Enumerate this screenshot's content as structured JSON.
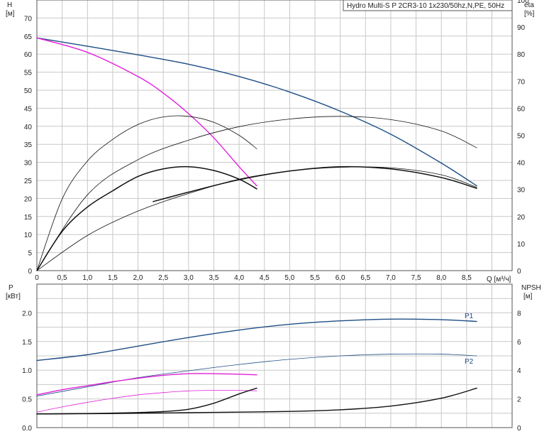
{
  "title": "Hydro Multi-S P 2CR3-10 1x230/50hz,N,PE, 50Hz",
  "colors": {
    "blue": "#1f4e86",
    "magenta": "#e020d8",
    "black": "#111111",
    "grid": "#c8c8c8"
  },
  "top_chart": {
    "y_left_label": "H",
    "y_left_unit": "[м]",
    "y_right_label": "eta",
    "y_right_unit": "[%]",
    "x_label": "Q [м³/ч]",
    "x_ticks": [
      "0",
      "0,5",
      "1,0",
      "1,5",
      "2,0",
      "2,5",
      "3,0",
      "3,5",
      "4,0",
      "4,5",
      "5,0",
      "5,5",
      "6,0",
      "6,5",
      "7,0",
      "7,5",
      "8,0",
      "8,5"
    ],
    "y_left_ticks": [
      "0",
      "5",
      "10",
      "15",
      "20",
      "25",
      "30",
      "35",
      "40",
      "45",
      "50",
      "55",
      "60",
      "65",
      "70"
    ],
    "y_right_ticks": [
      "0",
      "10",
      "20",
      "30",
      "40",
      "50",
      "60",
      "70",
      "80",
      "90",
      "100"
    ]
  },
  "bottom_chart": {
    "y_left_label": "P",
    "y_left_unit": "[кВт]",
    "y_right_label": "NPSH",
    "y_right_unit": "[м]",
    "y_left_ticks": [
      "0.0",
      "0.5",
      "1.0",
      "1.5",
      "2.0"
    ],
    "y_right_ticks": [
      "0",
      "2",
      "4",
      "6",
      "8"
    ],
    "series_labels": {
      "p1": "P1",
      "p2": "P2"
    }
  },
  "chart_data": [
    {
      "type": "line",
      "xlim": [
        0,
        9.4
      ],
      "ylim": [
        0,
        75
      ],
      "y2lim": [
        0,
        100
      ],
      "series": [
        {
          "key": "h_blue",
          "axis": "left",
          "color": "#1f4e86",
          "width": 1.4,
          "x": [
            0,
            1,
            2,
            3,
            4,
            5,
            6,
            7,
            8,
            8.7
          ],
          "y": [
            64.5,
            62.2,
            59.8,
            57.2,
            53.8,
            49.5,
            44.2,
            37.8,
            29.8,
            23.5
          ]
        },
        {
          "key": "h_magenta",
          "axis": "left",
          "color": "#e020d8",
          "width": 1.4,
          "x": [
            0,
            1,
            2,
            2.5,
            3,
            3.5,
            4,
            4.35
          ],
          "y": [
            64.5,
            60.5,
            53.8,
            49.2,
            43.5,
            36.8,
            28.8,
            23.5
          ]
        },
        {
          "key": "eta_thin_small",
          "axis": "right",
          "color": "#111111",
          "width": 0.8,
          "x": [
            0,
            0.5,
            1,
            1.5,
            2,
            2.5,
            3,
            3.5,
            4,
            4.35
          ],
          "y": [
            0,
            26.5,
            40.5,
            48.5,
            54.0,
            56.8,
            57.0,
            54.8,
            50.0,
            45.0
          ]
        },
        {
          "key": "eta_thick_small",
          "axis": "right",
          "color": "#111111",
          "width": 1.5,
          "x": [
            0,
            0.5,
            1,
            1.5,
            2,
            2.5,
            3,
            3.5,
            4,
            4.35
          ],
          "y": [
            0,
            14.5,
            23.5,
            29.5,
            34.8,
            37.6,
            38.4,
            37.0,
            33.8,
            30.2
          ]
        },
        {
          "key": "eta_thin_big",
          "axis": "right",
          "color": "#111111",
          "width": 0.8,
          "x": [
            0,
            1,
            2,
            3,
            4,
            5,
            6,
            7,
            8,
            8.7
          ],
          "y": [
            0,
            28.0,
            41.0,
            48.2,
            53.2,
            56.0,
            57.0,
            55.8,
            51.6,
            45.4
          ]
        },
        {
          "key": "eta_thin_big2",
          "axis": "right",
          "color": "#111111",
          "width": 0.8,
          "x": [
            0,
            1,
            2,
            3,
            4,
            5,
            6,
            7,
            8,
            8.7
          ],
          "y": [
            0,
            13.0,
            22.0,
            28.5,
            33.8,
            36.8,
            38.2,
            38.0,
            35.4,
            30.8
          ]
        },
        {
          "key": "eta_thick_big",
          "axis": "right",
          "color": "#111111",
          "width": 1.5,
          "x": [
            2.3,
            3,
            4,
            5,
            6,
            7,
            8,
            8.7
          ],
          "y": [
            25.5,
            29.0,
            33.6,
            36.8,
            38.4,
            37.6,
            34.4,
            30.4
          ]
        }
      ]
    },
    {
      "type": "line",
      "xlim": [
        0,
        9.4
      ],
      "ylim": [
        0,
        2.5
      ],
      "y2lim": [
        0,
        10
      ],
      "series": [
        {
          "key": "p1",
          "axis": "left",
          "color": "#1f4e86",
          "width": 1.4,
          "x": [
            0,
            1,
            2,
            3,
            4,
            5,
            6,
            7,
            8,
            8.7
          ],
          "y": [
            1.17,
            1.27,
            1.42,
            1.57,
            1.7,
            1.8,
            1.86,
            1.89,
            1.88,
            1.85
          ]
        },
        {
          "key": "p2",
          "axis": "left",
          "color": "#1f4e86",
          "width": 0.8,
          "x": [
            0,
            1,
            2,
            3,
            4,
            5,
            6,
            7,
            8,
            8.7
          ],
          "y": [
            0.55,
            0.71,
            0.87,
            0.99,
            1.1,
            1.19,
            1.25,
            1.28,
            1.28,
            1.25
          ]
        },
        {
          "key": "p1_magenta",
          "axis": "left",
          "color": "#e020d8",
          "width": 1.4,
          "x": [
            0,
            0.5,
            1,
            1.5,
            2,
            2.5,
            3,
            3.5,
            4,
            4.35
          ],
          "y": [
            0.57,
            0.66,
            0.73,
            0.8,
            0.86,
            0.91,
            0.94,
            0.94,
            0.93,
            0.92
          ]
        },
        {
          "key": "p2_magenta",
          "axis": "left",
          "color": "#e020d8",
          "width": 0.8,
          "x": [
            0,
            0.5,
            1,
            1.5,
            2,
            2.5,
            3,
            3.5,
            4,
            4.35
          ],
          "y": [
            0.27,
            0.36,
            0.44,
            0.51,
            0.57,
            0.61,
            0.64,
            0.65,
            0.65,
            0.64
          ]
        },
        {
          "key": "npsh_small",
          "axis": "right",
          "color": "#111111",
          "width": 1.4,
          "x": [
            0,
            1,
            2,
            2.5,
            3,
            3.5,
            4,
            4.35
          ],
          "y": [
            0.95,
            0.98,
            1.05,
            1.12,
            1.28,
            1.7,
            2.35,
            2.75
          ]
        },
        {
          "key": "npsh_big",
          "axis": "right",
          "color": "#111111",
          "width": 1.4,
          "x": [
            0,
            1,
            2,
            3,
            4,
            5,
            6,
            7,
            8,
            8.7
          ],
          "y": [
            0.95,
            0.97,
            1.0,
            1.04,
            1.08,
            1.13,
            1.24,
            1.5,
            2.05,
            2.75
          ]
        }
      ]
    }
  ]
}
